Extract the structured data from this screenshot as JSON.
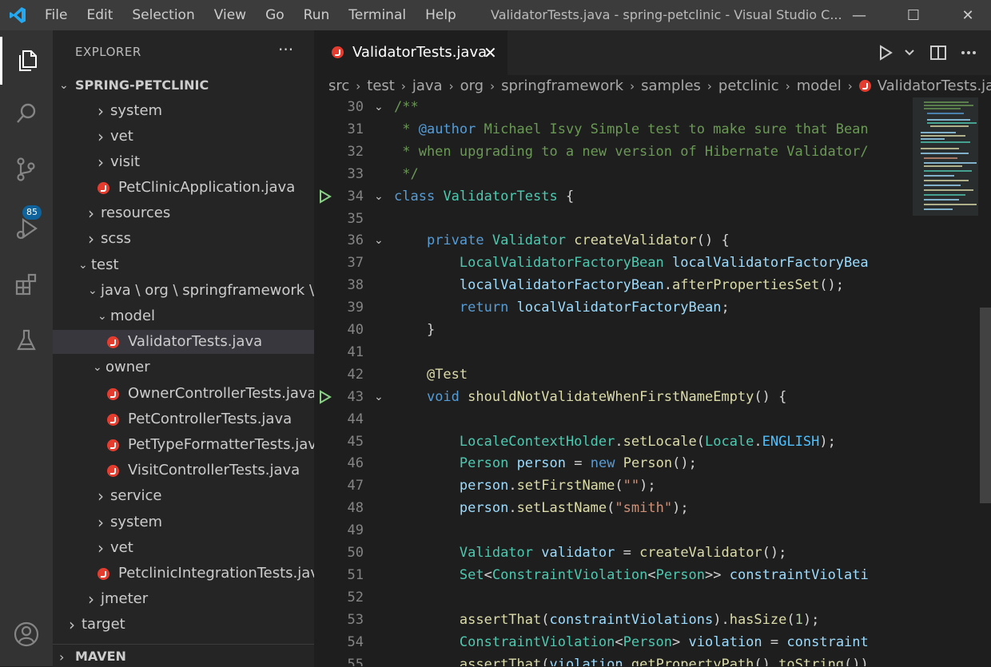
{
  "window": {
    "title": "ValidatorTests.java - spring-petclinic - Visual Studio C...",
    "menu": [
      "File",
      "Edit",
      "Selection",
      "View",
      "Go",
      "Run",
      "Terminal",
      "Help"
    ],
    "controls": {
      "minimize": "—",
      "maximize": "☐",
      "close": "✕"
    }
  },
  "activity_bar": {
    "items": [
      "explorer-icon",
      "search-icon",
      "source-control-icon",
      "run-debug-icon",
      "extensions-icon",
      "testing-icon",
      "account-icon"
    ],
    "scm_badge": "85"
  },
  "sidebar": {
    "header": "EXPLORER",
    "more": "···",
    "project": "SPRING-PETCLINIC",
    "tree": [
      {
        "label": "system",
        "type": "folder",
        "expanded": false
      },
      {
        "label": "vet",
        "type": "folder",
        "expanded": false
      },
      {
        "label": "visit",
        "type": "folder",
        "expanded": false
      },
      {
        "label": "PetClinicApplication.java",
        "type": "java"
      },
      {
        "label": "resources",
        "type": "folder",
        "expanded": false
      },
      {
        "label": "scss",
        "type": "folder",
        "expanded": false
      },
      {
        "label": "test",
        "type": "folder",
        "expanded": true
      },
      {
        "label": "java \\ org \\ springframework \\ ...",
        "type": "folder",
        "expanded": true
      },
      {
        "label": "model",
        "type": "folder",
        "expanded": true
      },
      {
        "label": "ValidatorTests.java",
        "type": "java",
        "selected": true
      },
      {
        "label": "owner",
        "type": "folder",
        "expanded": true
      },
      {
        "label": "OwnerControllerTests.java",
        "type": "java"
      },
      {
        "label": "PetControllerTests.java",
        "type": "java"
      },
      {
        "label": "PetTypeFormatterTests.java",
        "type": "java"
      },
      {
        "label": "VisitControllerTests.java",
        "type": "java"
      },
      {
        "label": "service",
        "type": "folder",
        "expanded": false
      },
      {
        "label": "system",
        "type": "folder",
        "expanded": false
      },
      {
        "label": "vet",
        "type": "folder",
        "expanded": false
      },
      {
        "label": "PetclinicIntegrationTests.java",
        "type": "java"
      },
      {
        "label": "jmeter",
        "type": "folder",
        "expanded": false
      },
      {
        "label": "target",
        "type": "folder",
        "expanded": false
      }
    ],
    "maven": "MAVEN"
  },
  "tab": {
    "label": "ValidatorTests.java",
    "close": "✕"
  },
  "breadcrumb": [
    "src",
    "test",
    "java",
    "org",
    "springframework",
    "samples",
    "petclinic",
    "model",
    "ValidatorTests.java"
  ],
  "editor": {
    "lines": [
      {
        "n": "30",
        "text": "/**"
      },
      {
        "n": "31",
        "text": " * @author Michael Isvy Simple test to make sure that Bean"
      },
      {
        "n": "32",
        "text": " * when upgrading to a new version of Hibernate Validator/"
      },
      {
        "n": "33",
        "text": " */"
      },
      {
        "n": "34",
        "text": "class ValidatorTests {"
      },
      {
        "n": "35",
        "text": ""
      },
      {
        "n": "36",
        "text": "    private Validator createValidator() {"
      },
      {
        "n": "37",
        "text": "        LocalValidatorFactoryBean localValidatorFactoryBea"
      },
      {
        "n": "38",
        "text": "        localValidatorFactoryBean.afterPropertiesSet();"
      },
      {
        "n": "39",
        "text": "        return localValidatorFactoryBean;"
      },
      {
        "n": "40",
        "text": "    }"
      },
      {
        "n": "41",
        "text": ""
      },
      {
        "n": "42",
        "text": "    @Test"
      },
      {
        "n": "43",
        "text": "    void shouldNotValidateWhenFirstNameEmpty() {"
      },
      {
        "n": "44",
        "text": ""
      },
      {
        "n": "45",
        "text": "        LocaleContextHolder.setLocale(Locale.ENGLISH);"
      },
      {
        "n": "46",
        "text": "        Person person = new Person();"
      },
      {
        "n": "47",
        "text": "        person.setFirstName(\"\");"
      },
      {
        "n": "48",
        "text": "        person.setLastName(\"smith\");"
      },
      {
        "n": "49",
        "text": ""
      },
      {
        "n": "50",
        "text": "        Validator validator = createValidator();"
      },
      {
        "n": "51",
        "text": "        Set<ConstraintViolation<Person>> constraintViolati"
      },
      {
        "n": "52",
        "text": ""
      },
      {
        "n": "53",
        "text": "        assertThat(constraintViolations).hasSize(1);"
      },
      {
        "n": "54",
        "text": "        ConstraintViolation<Person> violation = constraint"
      },
      {
        "n": "55",
        "text": "        assertThat(violation.getPropertyPath().toString())"
      }
    ]
  },
  "colors": {
    "titlebar": "#3c3c3c",
    "activity_bar": "#333333",
    "sidebar": "#252526",
    "editor": "#1e1e1e",
    "accent": "#0e639c",
    "java_icon": "#e43d2f",
    "run_glyph": "#89d185"
  }
}
